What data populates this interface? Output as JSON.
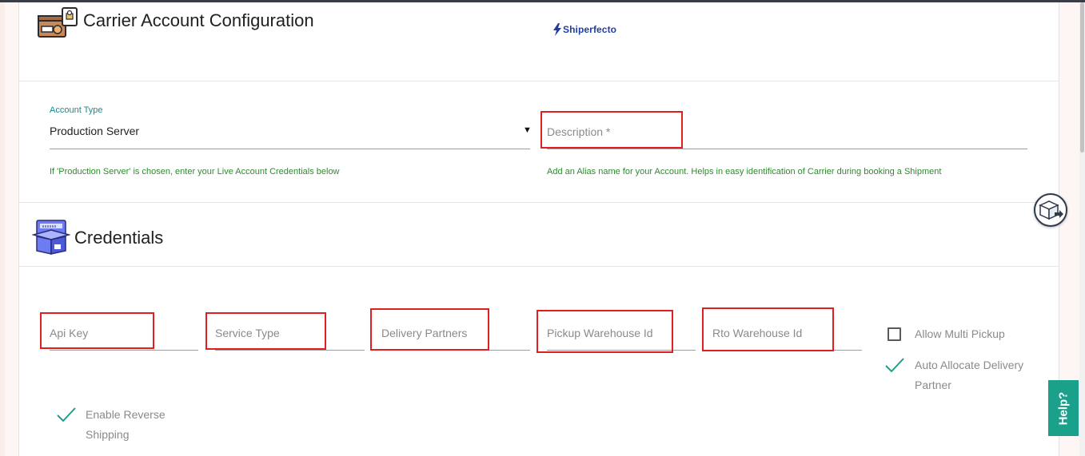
{
  "header": {
    "title": "Carrier Account Configuration",
    "brand": "Shiperfecto"
  },
  "account": {
    "type_label": "Account Type",
    "type_value": "Production Server",
    "type_hint": "If 'Production Server' is chosen, enter your Live Account Credentials below",
    "description_placeholder": "Description *",
    "description_hint": "Add an Alias name for your Account. Helps in easy identification of Carrier during booking a Shipment"
  },
  "credentials": {
    "title": "Credentials",
    "fields": [
      {
        "placeholder": "Api Key"
      },
      {
        "placeholder": "Service Type"
      },
      {
        "placeholder": "Delivery Partners"
      },
      {
        "placeholder": "Pickup Warehouse Id"
      },
      {
        "placeholder": "Rto Warehouse Id"
      }
    ],
    "allow_multi_pickup": {
      "label": "Allow Multi Pickup",
      "checked": false
    },
    "auto_allocate": {
      "label_line1": "Auto Allocate Delivery",
      "label_line2": "Partner",
      "checked": true
    },
    "enable_reverse": {
      "label_line1": "Enable Reverse",
      "label_line2": "Shipping",
      "checked": true
    }
  },
  "help": {
    "label": "Help?"
  },
  "colors": {
    "accent": "#1aa08b",
    "highlight": "#e02020",
    "hint": "#2e8b2e",
    "label": "#1b8a8a",
    "brand": "#1f3ea8"
  },
  "icons": [
    "carrier-account-icon",
    "shiperfecto-bolt-icon",
    "credentials-box-icon",
    "dropdown-caret-icon",
    "checkmark-icon",
    "shipment-box-icon"
  ]
}
